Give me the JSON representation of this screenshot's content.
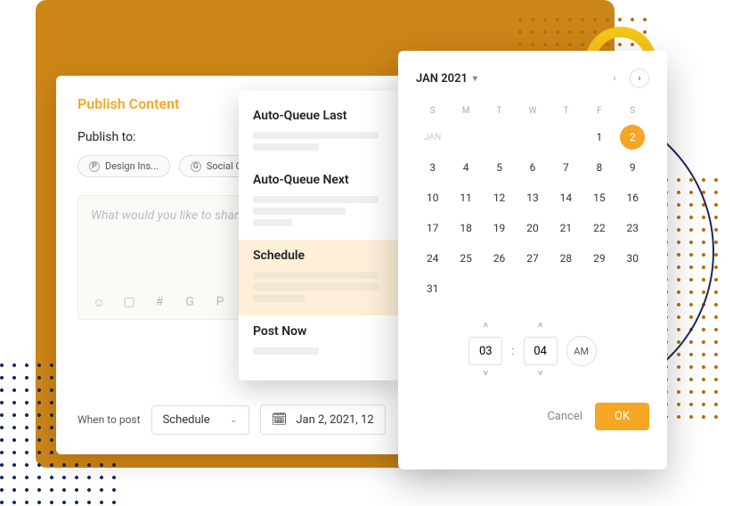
{
  "publish": {
    "title": "Publish Content",
    "publish_to_label": "Publish to:",
    "chips": [
      {
        "icon": "P",
        "label": "Design Ins..."
      },
      {
        "icon": "G",
        "label": "Social Cha..."
      }
    ],
    "compose_placeholder": "What would you like to share? Sta",
    "when_label": "When to post",
    "when_select_value": "Schedule",
    "date_value": "Jan 2, 2021, 12"
  },
  "dropdown": {
    "items": [
      {
        "label": "Auto-Queue Last",
        "selected": false
      },
      {
        "label": "Auto-Queue Next",
        "selected": false
      },
      {
        "label": "Schedule",
        "selected": true
      },
      {
        "label": "Post Now",
        "selected": false
      }
    ]
  },
  "calendar": {
    "month_label": "JAN 2021",
    "dow": [
      "S",
      "M",
      "T",
      "W",
      "T",
      "F",
      "S"
    ],
    "prefix_label": "JAN",
    "selected_day": 2,
    "days": [
      [
        null,
        null,
        null,
        null,
        null,
        1,
        2
      ],
      [
        3,
        4,
        5,
        6,
        7,
        8,
        9
      ],
      [
        10,
        11,
        12,
        13,
        14,
        15,
        16
      ],
      [
        17,
        18,
        19,
        20,
        21,
        22,
        23
      ],
      [
        24,
        25,
        26,
        27,
        28,
        29,
        30
      ],
      [
        31,
        null,
        null,
        null,
        null,
        null,
        null
      ]
    ],
    "time": {
      "hour": "03",
      "minute": "04",
      "ampm": "AM"
    },
    "actions": {
      "cancel": "Cancel",
      "ok": "OK"
    }
  }
}
